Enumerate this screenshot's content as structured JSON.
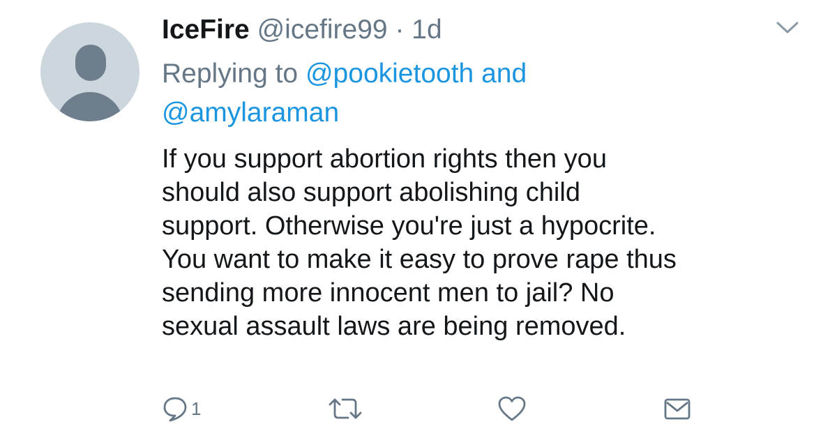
{
  "tweet": {
    "display_name": "IceFire",
    "handle": "@icefire99",
    "separator": "·",
    "time": "1d",
    "replying_prefix": "Replying to",
    "reply_mention_1": "@pookietooth",
    "reply_joiner": "and",
    "reply_mention_2": "@amylaraman",
    "text": "If you support abortion rights then you\nshould also support abolishing child\nsupport. Otherwise you're just a hypocrite.\nYou want to make it easy to prove rape thus\nsending more innocent men to jail? No\nsexual assault laws are being removed."
  },
  "actions": {
    "reply_count": "1"
  },
  "icons": {
    "menu": "chevron-down-icon",
    "reply": "reply-icon",
    "retweet": "retweet-icon",
    "like": "heart-icon",
    "direct_message": "envelope-icon"
  },
  "colors": {
    "link": "#1b95e0",
    "secondary_text": "#657786",
    "primary_text": "#14171a",
    "avatar_bg": "#ccd6dd",
    "avatar_fg": "#6e7e8c"
  }
}
